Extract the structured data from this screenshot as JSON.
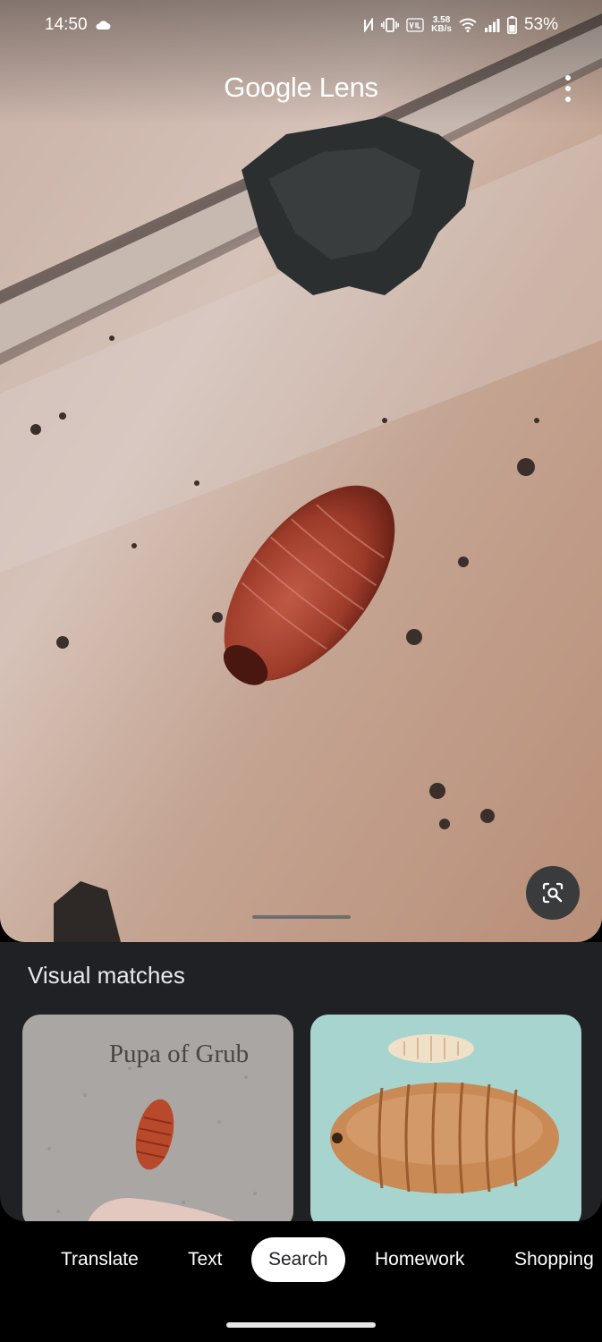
{
  "status_bar": {
    "time": "14:50",
    "net_speed_value": "3.58",
    "net_speed_unit": "KB/s",
    "battery": "53%",
    "icons": [
      "cloud-icon",
      "nfc-icon",
      "vibrate-icon",
      "volte-icon",
      "wifi-icon",
      "signal-icon",
      "battery-icon"
    ]
  },
  "header": {
    "title": "Google Lens"
  },
  "results": {
    "section_title": "Visual matches",
    "matches": [
      {
        "overlay_text": "Pupa of Grub"
      },
      {
        "overlay_text": ""
      }
    ]
  },
  "tabs": [
    {
      "label": "Translate"
    },
    {
      "label": "Text"
    },
    {
      "label": "Search",
      "active": true
    },
    {
      "label": "Homework"
    },
    {
      "label": "Shopping"
    }
  ],
  "colors": {
    "sheet_background": "#202124",
    "active_tab_background": "#ffffff",
    "active_tab_text": "#202124",
    "fab_background": "#3a3b3d"
  }
}
